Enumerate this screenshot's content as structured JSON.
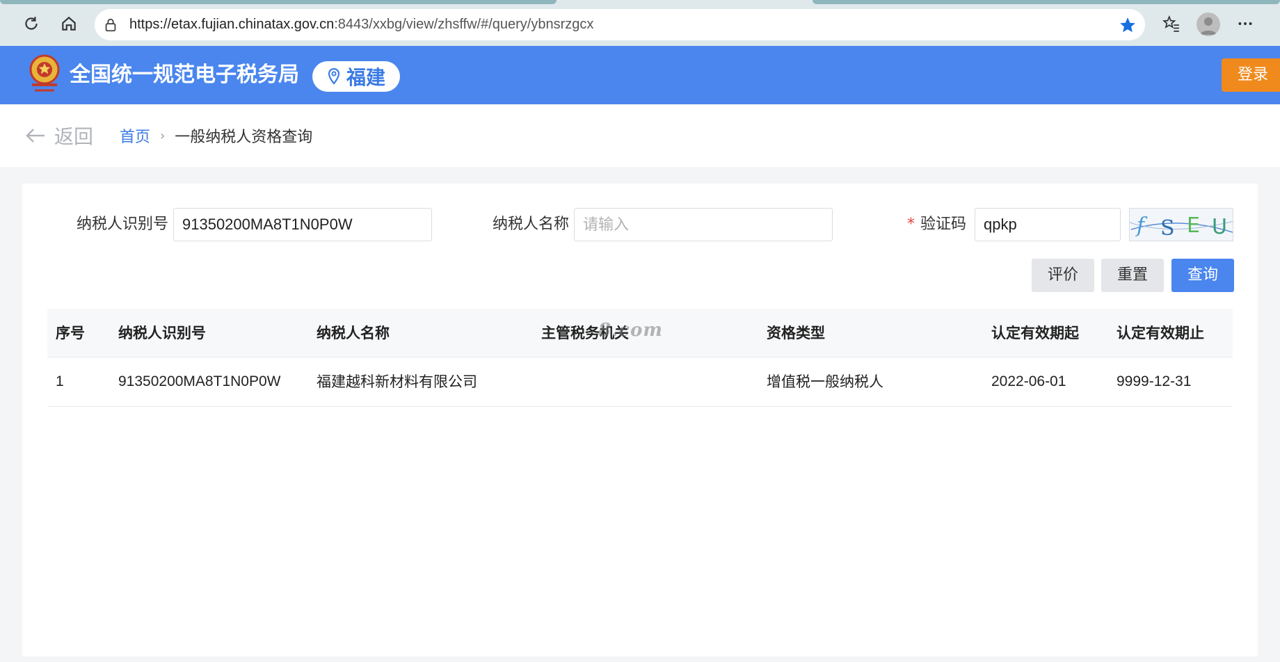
{
  "browser": {
    "url_host": "https://etax.fujian.chinatax.gov.cn",
    "url_rest": ":8443/xxbg/view/zhsffw/#/query/ybnsrzgcx"
  },
  "header": {
    "title": "全国统一规范电子税务局",
    "region": "福建",
    "login_label": "登录",
    "brand_color": "#4a86ee"
  },
  "breadcrumb": {
    "back_label": "返回",
    "home": "首页",
    "separator": "›",
    "current": "一般纳税人资格查询"
  },
  "form": {
    "taxpayer_id_label": "纳税人识别号",
    "taxpayer_id_value": "91350200MA8T1N0P0W",
    "taxpayer_name_label": "纳税人名称",
    "taxpayer_name_placeholder": "请输入",
    "captcha_required": "*",
    "captcha_label": "验证码",
    "captcha_value": "qpkp",
    "captcha_image_text": "fSEU"
  },
  "buttons": {
    "rate": "评价",
    "reset": "重置",
    "query": "查询"
  },
  "table": {
    "headers": [
      "序号",
      "纳税人识别号",
      "纳税人名称",
      "主管税务机关",
      "资格类型",
      "认定有效期起",
      "认定有效期止"
    ],
    "rows": [
      [
        "1",
        "91350200MA8T1N0P0W",
        "福建越科新材料有限公司",
        "",
        "增值税一般纳税人",
        "2022-06-01",
        "9999-12-31"
      ]
    ]
  },
  "watermark": "8.com"
}
